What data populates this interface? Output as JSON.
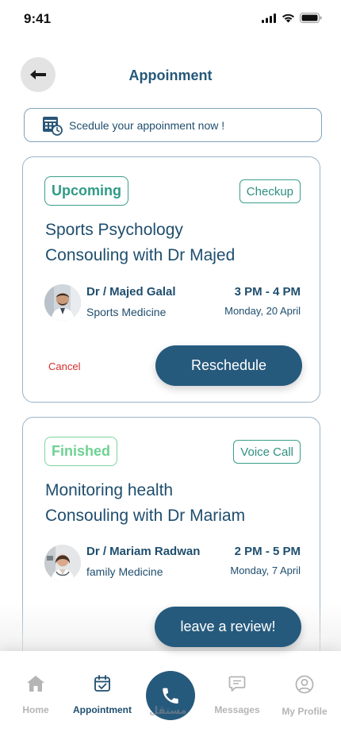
{
  "status_bar": {
    "time": "9:41"
  },
  "header": {
    "title": "Appoinment"
  },
  "schedule": {
    "label": "Scedule your appoinment now !"
  },
  "appointments": [
    {
      "status": "Upcoming",
      "type": "Checkup",
      "title_line1": "Sports Psychology",
      "title_line2": "Consouling with Dr Majed",
      "doctor": "Dr / Majed Galal",
      "specialty": "Sports Medicine",
      "time": "3 PM - 4 PM",
      "date": "Monday, 20 April",
      "cancel_label": "Cancel",
      "action_label": "Reschedule"
    },
    {
      "status": "Finished",
      "type": "Voice Call",
      "title_line1": "Monitoring health",
      "title_line2": "Consouling with Dr Mariam",
      "doctor": "Dr / Mariam Radwan",
      "specialty": "family Medicine",
      "time": "2 PM - 5 PM",
      "date": "Monday, 7 April",
      "action_label": "leave a review!"
    }
  ],
  "tab_bar": {
    "items": [
      {
        "label": "Home",
        "icon": "home-icon"
      },
      {
        "label": "Appointment",
        "icon": "calendar-check-icon",
        "active": true
      },
      {
        "label": "",
        "icon": "phone-icon"
      },
      {
        "label": "Messages",
        "icon": "message-icon"
      },
      {
        "label": "My Profile",
        "icon": "user-icon"
      }
    ],
    "watermark": "مستقل"
  },
  "colors": {
    "primary": "#265a7d",
    "upcoming": "#2f9b86",
    "finished": "#6fd193",
    "cancel": "#d62d2d"
  }
}
